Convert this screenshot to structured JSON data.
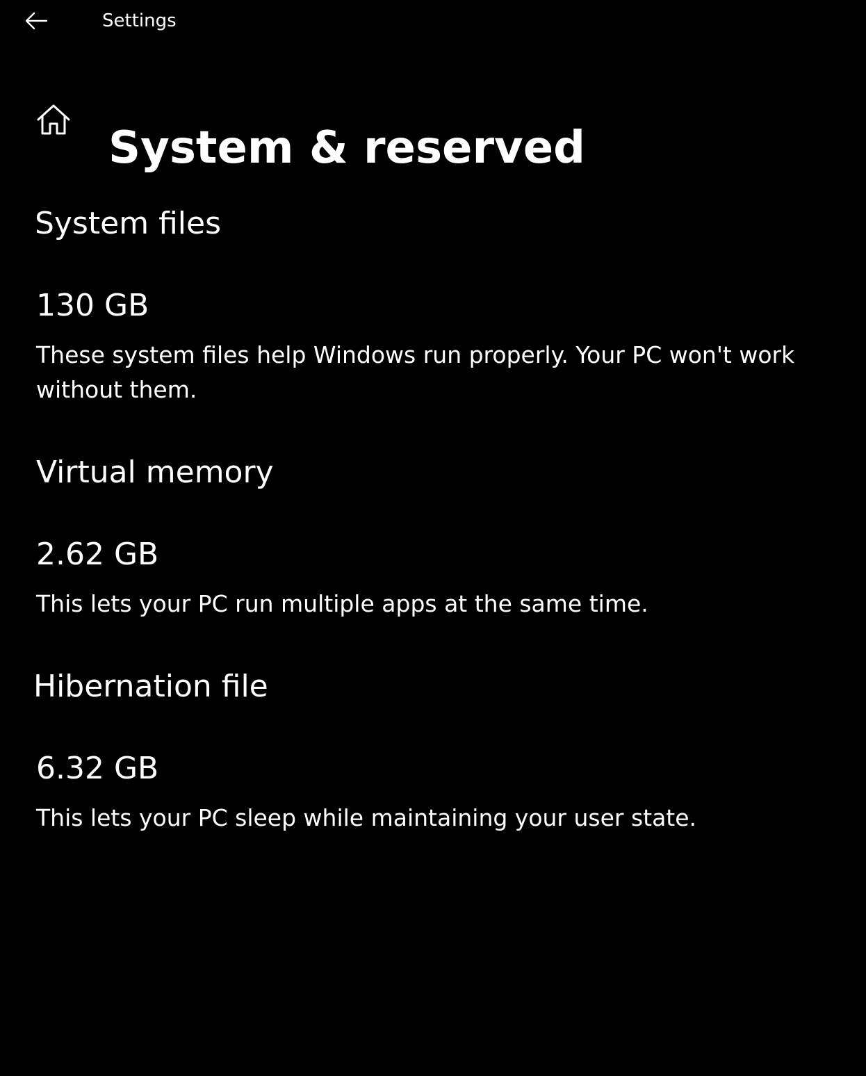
{
  "window": {
    "title": "Settings",
    "back_icon": "back-arrow-icon"
  },
  "header": {
    "home_icon": "home-icon",
    "title": "System & reserved"
  },
  "sections": [
    {
      "heading": "System files",
      "size": "130 GB",
      "description": "These system files help Windows run properly. Your PC won't work without them."
    },
    {
      "heading": "Virtual memory",
      "size": "2.62 GB",
      "description": "This lets your PC run multiple apps at the same time."
    },
    {
      "heading": "Hibernation file",
      "size": "6.32 GB",
      "description": "This lets your PC sleep while maintaining your user state."
    }
  ],
  "colors": {
    "background": "#000000",
    "text": "#ffffff"
  }
}
